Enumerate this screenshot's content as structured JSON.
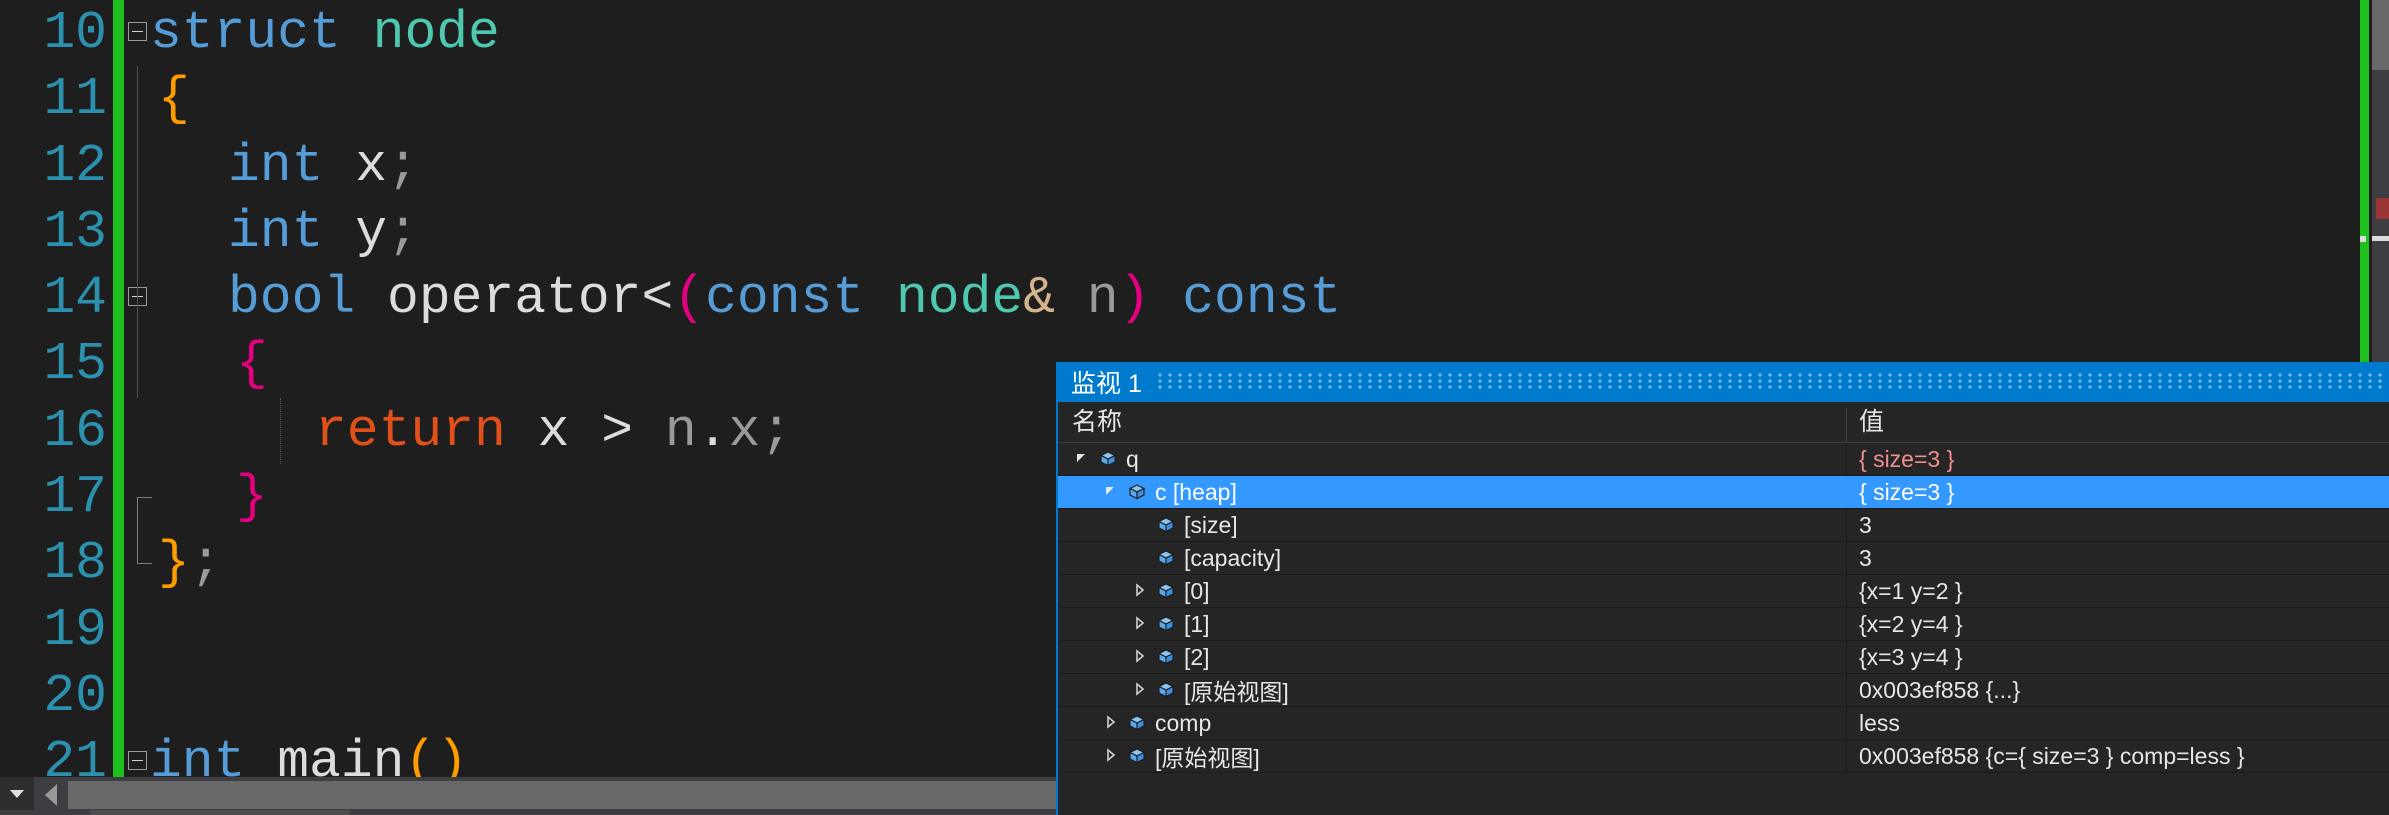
{
  "editor": {
    "lines": [
      {
        "no": "10",
        "glyph": true,
        "guide": "none",
        "tokens": [
          {
            "t": "struct ",
            "c": "kw"
          },
          {
            "t": "node",
            "c": "type"
          }
        ]
      },
      {
        "no": "11",
        "glyph": false,
        "guide": "vert",
        "tokens": [
          {
            "t": "{",
            "c": "brace-o"
          }
        ],
        "indent": 8
      },
      {
        "no": "12",
        "glyph": false,
        "guide": "vert",
        "tokens": [
          {
            "t": "int",
            "c": "kw"
          },
          {
            "t": " x",
            "c": "plain"
          },
          {
            "t": ";",
            "c": "var"
          }
        ],
        "indent": 78
      },
      {
        "no": "13",
        "glyph": false,
        "guide": "vert",
        "tokens": [
          {
            "t": "int",
            "c": "kw"
          },
          {
            "t": " y",
            "c": "plain"
          },
          {
            "t": ";",
            "c": "var"
          }
        ],
        "indent": 78
      },
      {
        "no": "14",
        "glyph": true,
        "guide": "vert",
        "tokens": [
          {
            "t": "bool",
            "c": "kw"
          },
          {
            "t": " operator<",
            "c": "plain"
          },
          {
            "t": "(",
            "c": "brace-m"
          },
          {
            "t": "const ",
            "c": "kw"
          },
          {
            "t": "node",
            "c": "type"
          },
          {
            "t": "&",
            "c": "amp"
          },
          {
            "t": " n",
            "c": "var"
          },
          {
            "t": ")",
            "c": "brace-m"
          },
          {
            "t": " ",
            "c": "plain"
          },
          {
            "t": "const",
            "c": "kw"
          }
        ],
        "indent": 78
      },
      {
        "no": "15",
        "glyph": false,
        "guide": "vert",
        "tokens": [
          {
            "t": "{",
            "c": "brace-m"
          }
        ],
        "indent": 86
      },
      {
        "no": "16",
        "glyph": false,
        "guide": "dotted",
        "tokens": [
          {
            "t": "return",
            "c": "ctrl"
          },
          {
            "t": " x > ",
            "c": "plain"
          },
          {
            "t": "n",
            "c": "var"
          },
          {
            "t": ".",
            "c": "plain"
          },
          {
            "t": "x",
            "c": "var"
          },
          {
            "t": ";",
            "c": "var"
          }
        ],
        "indent": 165
      },
      {
        "no": "17",
        "glyph": false,
        "guide": "bracket-top",
        "tokens": [
          {
            "t": "}",
            "c": "brace-m"
          }
        ],
        "indent": 86
      },
      {
        "no": "18",
        "glyph": false,
        "guide": "bracket-bot",
        "tokens": [
          {
            "t": "}",
            "c": "brace-o"
          },
          {
            "t": ";",
            "c": "var"
          }
        ],
        "indent": 8
      },
      {
        "no": "19",
        "glyph": false,
        "guide": "none",
        "tokens": []
      },
      {
        "no": "20",
        "glyph": false,
        "guide": "none",
        "tokens": []
      },
      {
        "no": "21",
        "glyph": true,
        "guide": "none",
        "tokens": [
          {
            "t": "int",
            "c": "kw"
          },
          {
            "t": " main",
            "c": "plain"
          },
          {
            "t": "()",
            "c": "brace-o"
          }
        ]
      }
    ],
    "colors": {
      "background": "#1e1e1e",
      "line_number": "#2b91af",
      "change_bar": "#1ec01e",
      "keyword": "#569cd6",
      "type": "#4ec9b0",
      "control": "#e2501a",
      "brace_orange": "#ff9d00",
      "brace_magenta": "#e5007f",
      "plain": "#dcdcdc"
    }
  },
  "scrollbar": {
    "dropdown_icon": "chevron-down-icon",
    "left_arrow_icon": "arrow-left-icon"
  },
  "watch": {
    "title": "监视 1",
    "columns": {
      "name": "名称",
      "value": "值"
    },
    "accent": "#007acc",
    "selection": "#3399ff",
    "rows": [
      {
        "indent": 0,
        "expander": "open",
        "name": "q",
        "value": "{ size=3 }",
        "changed": true,
        "selected": false
      },
      {
        "indent": 1,
        "expander": "open",
        "name": "c [heap]",
        "value": "{ size=3 }",
        "changed": false,
        "selected": true
      },
      {
        "indent": 2,
        "expander": "none",
        "name": "[size]",
        "value": "3",
        "changed": false,
        "selected": false
      },
      {
        "indent": 2,
        "expander": "none",
        "name": "[capacity]",
        "value": "3",
        "changed": false,
        "selected": false
      },
      {
        "indent": 2,
        "expander": "closed",
        "name": "[0]",
        "value": "{x=1 y=2 }",
        "changed": false,
        "selected": false
      },
      {
        "indent": 2,
        "expander": "closed",
        "name": "[1]",
        "value": "{x=2 y=4 }",
        "changed": false,
        "selected": false
      },
      {
        "indent": 2,
        "expander": "closed",
        "name": "[2]",
        "value": "{x=3 y=4 }",
        "changed": false,
        "selected": false
      },
      {
        "indent": 2,
        "expander": "closed",
        "name": "[原始视图]",
        "value": "0x003ef858 {...}",
        "changed": false,
        "selected": false
      },
      {
        "indent": 1,
        "expander": "closed",
        "name": "comp",
        "value": "less",
        "changed": false,
        "selected": false
      },
      {
        "indent": 1,
        "expander": "closed",
        "name": "[原始视图]",
        "value": "0x003ef858 {c={ size=3 } comp=less }",
        "changed": false,
        "selected": false
      }
    ],
    "icons": {
      "node": "cube-icon",
      "expander_open": "triangle-down-icon",
      "expander_closed": "triangle-right-icon"
    }
  }
}
